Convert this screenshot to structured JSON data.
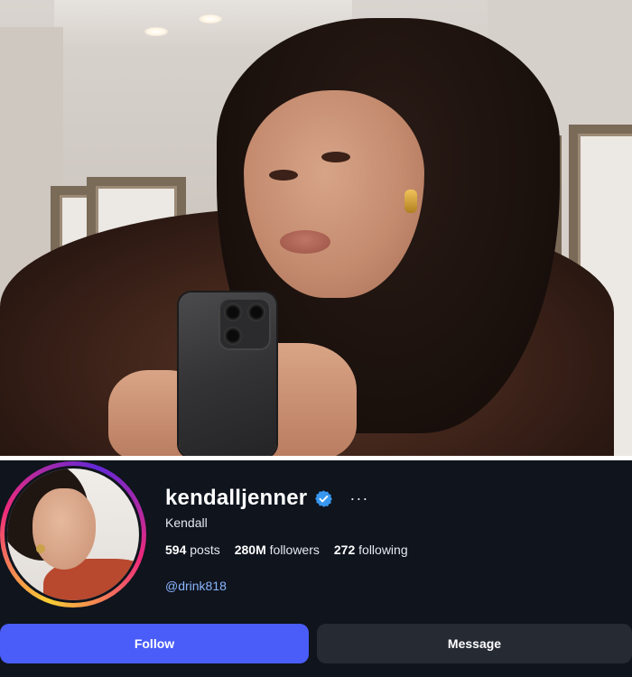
{
  "photo": {
    "description_icon": "selfie-photo"
  },
  "profile": {
    "username": "kendalljenner",
    "verified_icon": "verified-badge-icon",
    "more_label": "···",
    "display_name": "Kendall",
    "stats": {
      "posts_count": "594",
      "posts_label": "posts",
      "followers_count": "280M",
      "followers_label": "followers",
      "following_count": "272",
      "following_label": "following"
    },
    "link": "@drink818",
    "buttons": {
      "follow": "Follow",
      "message": "Message"
    }
  },
  "colors": {
    "panel_bg": "#0f141d",
    "follow_button": "#4a5df9",
    "message_button": "#252a33",
    "link": "#8ab4ff",
    "verified": "#3897f0"
  }
}
